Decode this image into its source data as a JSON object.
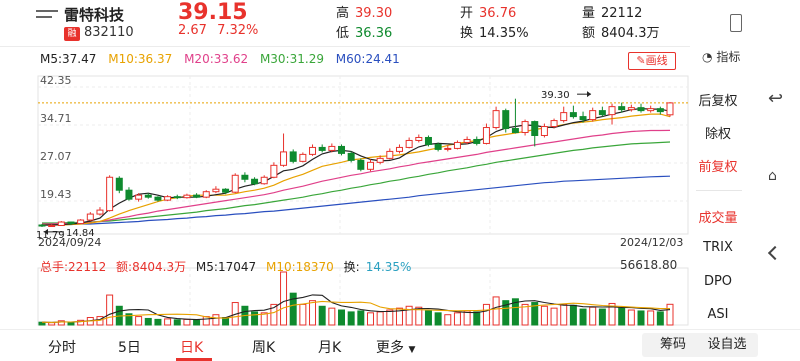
{
  "header": {
    "name": "雷特科技",
    "badge": "融",
    "code": "832110",
    "price": "39.15",
    "change": "2.67",
    "change_pct": "7.32%",
    "high_label": "高",
    "high": "39.30",
    "low_label": "低",
    "low": "36.36",
    "open_label": "开",
    "open": "36.76",
    "turnover_label": "换",
    "turnover": "14.35%",
    "volume_label": "量",
    "volume": "22112",
    "amount_label": "额",
    "amount": "8404.3万"
  },
  "ma": {
    "m5": "M5:37.47",
    "m10": "M10:36.37",
    "m20": "M20:33.62",
    "m30": "M30:31.29",
    "m60": "M60:24.41",
    "colors": {
      "m5": "#222222",
      "m10": "#e8a200",
      "m20": "#e0408a",
      "m30": "#3aa63a",
      "m60": "#2a4fbf"
    }
  },
  "draw_button": "画线",
  "indicator_label": "指标",
  "right_panel": [
    "后复权",
    "除权",
    "前复权",
    "成交量",
    "TRIX",
    "DPO",
    "ASI"
  ],
  "volume_info": {
    "total": "总手:22112",
    "amount": "额:8404.3万",
    "m5": "M5:17047",
    "m10": "M10:18370",
    "turnover_label": "换:",
    "turnover": "14.35%",
    "max": "56618.80"
  },
  "tabs": [
    "分时",
    "5日",
    "日K",
    "周K",
    "月K",
    "更多"
  ],
  "active_tab": "日K",
  "tab_buttons": [
    "筹码",
    "设自选"
  ],
  "chart_data": {
    "type": "candlestick",
    "yticks": [
      "42.35",
      "34.71",
      "27.07",
      "19.43"
    ],
    "ylim": [
      14.0,
      42.35
    ],
    "x_start": "2024/09/24",
    "x_end": "2024/12/03",
    "high_mark": "39.30",
    "low_mark": "14.84",
    "low_mark_left": "11.79",
    "candles": [
      [
        14.6,
        14.4,
        14.8,
        14.2
      ],
      [
        14.4,
        14.5,
        14.7,
        14.3
      ],
      [
        14.5,
        15.2,
        15.4,
        14.4
      ],
      [
        15.2,
        14.9,
        15.3,
        14.6
      ],
      [
        14.9,
        15.6,
        15.8,
        14.8
      ],
      [
        15.6,
        16.8,
        17.2,
        15.4
      ],
      [
        16.8,
        17.6,
        18.2,
        16.5
      ],
      [
        17.5,
        24.2,
        24.6,
        17.3
      ],
      [
        24.0,
        21.6,
        24.4,
        21.0
      ],
      [
        21.6,
        19.8,
        22.2,
        19.5
      ],
      [
        19.8,
        20.6,
        21.0,
        19.3
      ],
      [
        20.6,
        20.2,
        21.0,
        19.9
      ],
      [
        20.2,
        19.6,
        20.4,
        19.3
      ],
      [
        19.6,
        20.3,
        20.6,
        19.4
      ],
      [
        20.3,
        20.1,
        20.7,
        19.8
      ],
      [
        20.1,
        20.6,
        20.9,
        19.9
      ],
      [
        20.6,
        20.2,
        21.0,
        20.0
      ],
      [
        20.2,
        21.3,
        21.6,
        20.0
      ],
      [
        21.3,
        21.8,
        22.4,
        21.0
      ],
      [
        21.8,
        21.2,
        22.0,
        20.8
      ],
      [
        21.2,
        24.6,
        25.0,
        21.0
      ],
      [
        24.6,
        23.8,
        25.2,
        23.2
      ],
      [
        23.8,
        22.9,
        24.2,
        22.6
      ],
      [
        22.9,
        24.2,
        24.6,
        22.7
      ],
      [
        24.2,
        26.6,
        27.2,
        24.0
      ],
      [
        26.6,
        29.3,
        33.0,
        26.3
      ],
      [
        29.3,
        27.4,
        29.8,
        27.0
      ],
      [
        27.4,
        28.8,
        29.2,
        27.2
      ],
      [
        28.8,
        30.2,
        30.8,
        28.5
      ],
      [
        30.2,
        29.6,
        30.8,
        29.2
      ],
      [
        29.6,
        30.4,
        31.0,
        29.2
      ],
      [
        30.4,
        29.0,
        30.8,
        28.6
      ],
      [
        29.0,
        27.6,
        29.4,
        27.2
      ],
      [
        27.6,
        25.8,
        28.0,
        25.4
      ],
      [
        25.8,
        27.2,
        27.8,
        25.4
      ],
      [
        27.2,
        28.0,
        28.6,
        26.8
      ],
      [
        28.0,
        29.4,
        30.0,
        27.8
      ],
      [
        29.4,
        30.2,
        30.8,
        29.0
      ],
      [
        30.2,
        31.6,
        32.2,
        30.0
      ],
      [
        31.6,
        32.2,
        32.8,
        31.2
      ],
      [
        32.2,
        30.8,
        32.6,
        30.4
      ],
      [
        30.8,
        29.8,
        31.2,
        29.4
      ],
      [
        29.8,
        30.0,
        30.6,
        29.4
      ],
      [
        30.0,
        31.2,
        31.6,
        29.8
      ],
      [
        31.2,
        31.8,
        32.4,
        30.8
      ],
      [
        31.8,
        31.0,
        32.4,
        30.6
      ],
      [
        31.0,
        34.2,
        35.0,
        30.8
      ],
      [
        34.2,
        37.6,
        38.4,
        33.8
      ],
      [
        37.6,
        34.0,
        38.0,
        33.2
      ],
      [
        34.0,
        33.2,
        40.0,
        33.0
      ],
      [
        33.2,
        35.4,
        35.8,
        32.6
      ],
      [
        35.4,
        32.6,
        35.6,
        30.4
      ],
      [
        32.6,
        34.4,
        35.0,
        32.2
      ],
      [
        34.4,
        35.6,
        36.0,
        34.0
      ],
      [
        35.6,
        37.2,
        38.4,
        35.2
      ],
      [
        37.2,
        36.4,
        38.6,
        36.0
      ],
      [
        36.4,
        35.8,
        37.4,
        35.2
      ],
      [
        35.8,
        37.6,
        38.2,
        35.4
      ],
      [
        37.6,
        36.8,
        38.4,
        36.4
      ],
      [
        36.8,
        38.4,
        39.0,
        34.8
      ],
      [
        38.4,
        37.8,
        39.2,
        37.2
      ],
      [
        37.8,
        38.2,
        38.8,
        37.4
      ],
      [
        38.2,
        37.6,
        39.0,
        37.2
      ],
      [
        37.6,
        38.0,
        38.6,
        37.2
      ],
      [
        38.0,
        37.4,
        38.4,
        36.8
      ],
      [
        36.76,
        39.15,
        39.3,
        36.36
      ]
    ],
    "ma5": [
      14.6,
      14.6,
      14.7,
      14.8,
      15.0,
      15.4,
      16.0,
      17.8,
      19.0,
      20.0,
      20.8,
      21.0,
      20.6,
      20.1,
      20.2,
      20.2,
      20.2,
      20.4,
      20.7,
      21.0,
      21.8,
      22.4,
      22.8,
      23.3,
      24.4,
      25.5,
      25.8,
      26.5,
      27.8,
      28.9,
      29.4,
      29.6,
      29.4,
      28.5,
      27.8,
      27.5,
      27.6,
      28.1,
      29.3,
      30.3,
      30.8,
      31.0,
      30.9,
      30.8,
      30.9,
      31.4,
      32.2,
      33.4,
      34.1,
      34.4,
      34.7,
      34.6,
      34.3,
      34.2,
      34.7,
      35.2,
      35.5,
      36.0,
      36.4,
      36.9,
      37.3,
      37.8,
      38.0,
      37.9,
      37.9,
      37.47
    ],
    "ma10": [
      14.6,
      14.6,
      14.6,
      14.7,
      14.8,
      15.0,
      15.3,
      16.0,
      16.8,
      17.5,
      18.1,
      18.7,
      19.3,
      19.8,
      20.1,
      20.4,
      20.6,
      20.6,
      20.6,
      20.6,
      20.9,
      21.3,
      21.6,
      22.0,
      22.6,
      23.5,
      24.2,
      24.8,
      25.6,
      26.4,
      26.8,
      27.2,
      27.7,
      27.9,
      28.2,
      28.4,
      28.5,
      28.7,
      29.0,
      29.3,
      29.7,
      30.1,
      30.6,
      31.0,
      31.3,
      31.6,
      32.1,
      32.5,
      32.8,
      33.1,
      33.4,
      33.8,
      34.1,
      34.4,
      34.8,
      35.1,
      35.3,
      35.5,
      35.8,
      36.0,
      36.2,
      36.5,
      36.7,
      36.9,
      36.9,
      36.37
    ],
    "ma20": [
      14.8,
      14.8,
      14.9,
      14.9,
      15.0,
      15.1,
      15.3,
      15.6,
      16.0,
      16.3,
      16.7,
      17.0,
      17.4,
      17.7,
      18.0,
      18.3,
      18.6,
      18.9,
      19.2,
      19.5,
      19.8,
      20.1,
      20.4,
      20.7,
      21.1,
      21.6,
      22.0,
      22.4,
      22.9,
      23.4,
      23.8,
      24.2,
      24.6,
      24.9,
      25.3,
      25.6,
      25.9,
      26.3,
      26.6,
      27.0,
      27.3,
      27.6,
      27.9,
      28.2,
      28.5,
      28.8,
      29.2,
      29.5,
      29.8,
      30.1,
      30.4,
      30.7,
      31.0,
      31.3,
      31.6,
      31.9,
      32.2,
      32.5,
      32.7,
      33.0,
      33.2,
      33.4,
      33.5,
      33.6,
      33.6,
      33.62
    ],
    "ma30": [
      15.0,
      15.0,
      15.0,
      15.1,
      15.1,
      15.2,
      15.3,
      15.4,
      15.6,
      15.8,
      16.0,
      16.2,
      16.4,
      16.6,
      16.8,
      17.0,
      17.2,
      17.5,
      17.7,
      17.9,
      18.2,
      18.5,
      18.7,
      19.0,
      19.3,
      19.6,
      19.9,
      20.2,
      20.6,
      20.9,
      21.3,
      21.6,
      22.0,
      22.3,
      22.7,
      23.0,
      23.4,
      23.7,
      24.1,
      24.4,
      24.8,
      25.1,
      25.5,
      25.8,
      26.1,
      26.5,
      26.8,
      27.2,
      27.5,
      27.8,
      28.1,
      28.4,
      28.7,
      29.0,
      29.3,
      29.6,
      29.8,
      30.1,
      30.3,
      30.5,
      30.7,
      30.9,
      31.0,
      31.1,
      31.2,
      31.29
    ],
    "ma60": [
      14.6,
      14.6,
      14.7,
      14.7,
      14.8,
      14.8,
      14.9,
      15.0,
      15.1,
      15.2,
      15.3,
      15.5,
      15.6,
      15.7,
      15.9,
      16.0,
      16.2,
      16.3,
      16.5,
      16.6,
      16.8,
      16.9,
      17.1,
      17.3,
      17.4,
      17.6,
      17.8,
      18.0,
      18.2,
      18.4,
      18.6,
      18.8,
      19.0,
      19.2,
      19.4,
      19.6,
      19.8,
      20.0,
      20.2,
      20.5,
      20.7,
      20.9,
      21.1,
      21.3,
      21.5,
      21.7,
      21.9,
      22.1,
      22.3,
      22.5,
      22.7,
      22.9,
      23.1,
      23.2,
      23.4,
      23.5,
      23.6,
      23.7,
      23.8,
      23.9,
      24.0,
      24.1,
      24.2,
      24.3,
      24.35,
      24.41
    ],
    "volumes": [
      3000,
      2500,
      4500,
      3000,
      5000,
      8000,
      9000,
      32000,
      20000,
      12000,
      9000,
      7000,
      6000,
      6500,
      5500,
      6000,
      5000,
      9000,
      11000,
      8000,
      24000,
      20000,
      14000,
      13000,
      22000,
      56618.8,
      34000,
      22000,
      26000,
      20000,
      18000,
      16000,
      14000,
      15000,
      13000,
      14000,
      16000,
      18000,
      20000,
      19000,
      15000,
      13000,
      11000,
      13000,
      15000,
      14000,
      22000,
      30000,
      26000,
      28000,
      22000,
      24000,
      20000,
      18000,
      22000,
      21000,
      17000,
      19000,
      17000,
      23000,
      18000,
      16000,
      15000,
      15000,
      14000,
      22112
    ]
  }
}
